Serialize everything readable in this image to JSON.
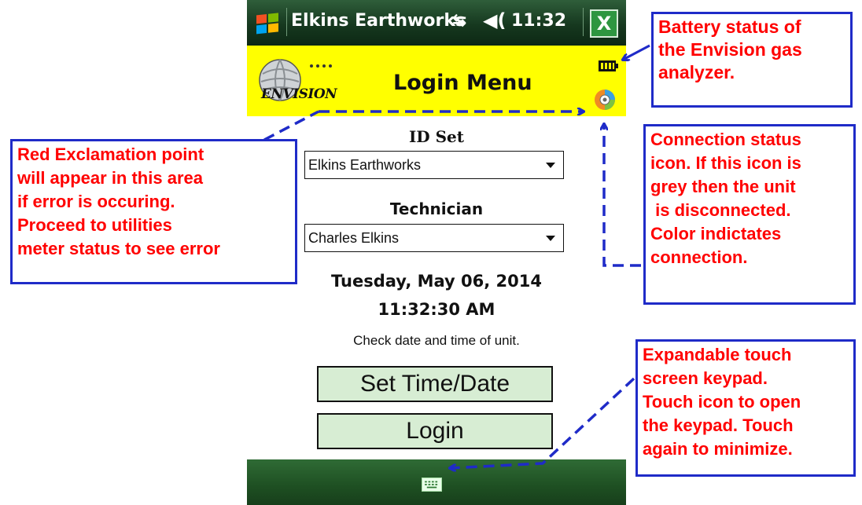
{
  "titlebar": {
    "app_title": "Elkins Earthworks",
    "time": "11:32",
    "close_label": "X",
    "connectivity_glyph": "⇆",
    "volume_glyph": "◀(",
    "icons": [
      "windows-start-icon",
      "connectivity-icon",
      "volume-icon",
      "close-icon"
    ]
  },
  "header": {
    "logo_text": "ENVISION",
    "title": "Login Menu",
    "icons": [
      "battery-icon",
      "connection-status-icon"
    ]
  },
  "form": {
    "id_set_label": "ID Set",
    "id_set_value": "Elkins Earthworks",
    "technician_label": "Technician",
    "technician_value": "Charles Elkins",
    "date": "Tuesday, May 06, 2014",
    "time": "11:32:30 AM",
    "check_text": "Check date and time of unit.",
    "set_time_button": "Set Time/Date",
    "login_button": "Login"
  },
  "bottombar": {
    "icons": [
      "keyboard-icon"
    ]
  },
  "annotations": {
    "battery": [
      "Battery status of",
      "the Envision gas",
      "analyzer."
    ],
    "error": [
      "Red Exclamation point",
      "will appear in this area",
      "if error is occuring.",
      "Proceed to utilities",
      "meter status to see error"
    ],
    "connection": [
      "Connection status",
      "icon. If this icon is",
      "grey then the unit",
      " is disconnected.",
      "Color indictates",
      "connection."
    ],
    "keypad": [
      "Expandable touch",
      "screen keypad.",
      "Touch icon to open",
      "the keypad. Touch",
      "again to minimize."
    ]
  },
  "colors": {
    "header_yellow": "#ffff00",
    "button_green": "#d7edd3",
    "annotation_red": "#ff0000",
    "annotation_blue": "#1f2bc8",
    "titlebar_green": "#16381f"
  }
}
